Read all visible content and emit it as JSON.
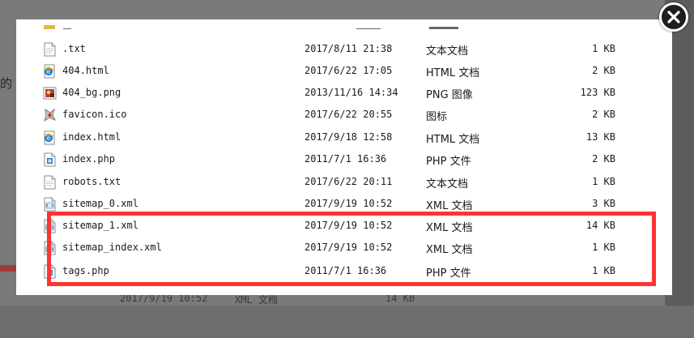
{
  "background": {
    "fragment_text": "的",
    "bottom_row": {
      "date": "2017/9/19 10:52",
      "type": "XML 文档",
      "size": "14 KB"
    }
  },
  "files": [
    {
      "name": ".txt",
      "date": "2017/8/11 21:38",
      "type": "文本文档",
      "size": "1 KB",
      "icon": "text-file-icon"
    },
    {
      "name": "404.html",
      "date": "2017/6/22 17:05",
      "type": "HTML 文档",
      "size": "2 KB",
      "icon": "html-file-icon"
    },
    {
      "name": "404_bg.png",
      "date": "2013/11/16 14:34",
      "type": "PNG 图像",
      "size": "123 KB",
      "icon": "png-file-icon"
    },
    {
      "name": "favicon.ico",
      "date": "2017/6/22 20:55",
      "type": "图标",
      "size": "2 KB",
      "icon": "ico-file-icon"
    },
    {
      "name": "index.html",
      "date": "2017/9/18 12:58",
      "type": "HTML 文档",
      "size": "13 KB",
      "icon": "html-file-icon"
    },
    {
      "name": "index.php",
      "date": "2011/7/1 16:36",
      "type": "PHP 文件",
      "size": "2 KB",
      "icon": "php-file-icon"
    },
    {
      "name": "robots.txt",
      "date": "2017/6/22 20:11",
      "type": "文本文档",
      "size": "1 KB",
      "icon": "text-file-icon"
    },
    {
      "name": "sitemap_0.xml",
      "date": "2017/9/19 10:52",
      "type": "XML 文档",
      "size": "3 KB",
      "icon": "xml-file-icon"
    },
    {
      "name": "sitemap_1.xml",
      "date": "2017/9/19 10:52",
      "type": "XML 文档",
      "size": "14 KB",
      "icon": "xml-file-icon"
    },
    {
      "name": "sitemap_index.xml",
      "date": "2017/9/19 10:52",
      "type": "XML 文档",
      "size": "1 KB",
      "icon": "xml-file-icon"
    },
    {
      "name": "tags.php",
      "date": "2011/7/1 16:36",
      "type": "PHP 文件",
      "size": "1 KB",
      "icon": "php-file-icon"
    }
  ],
  "highlight_color": "#ff3333",
  "close_icon": "close-icon"
}
